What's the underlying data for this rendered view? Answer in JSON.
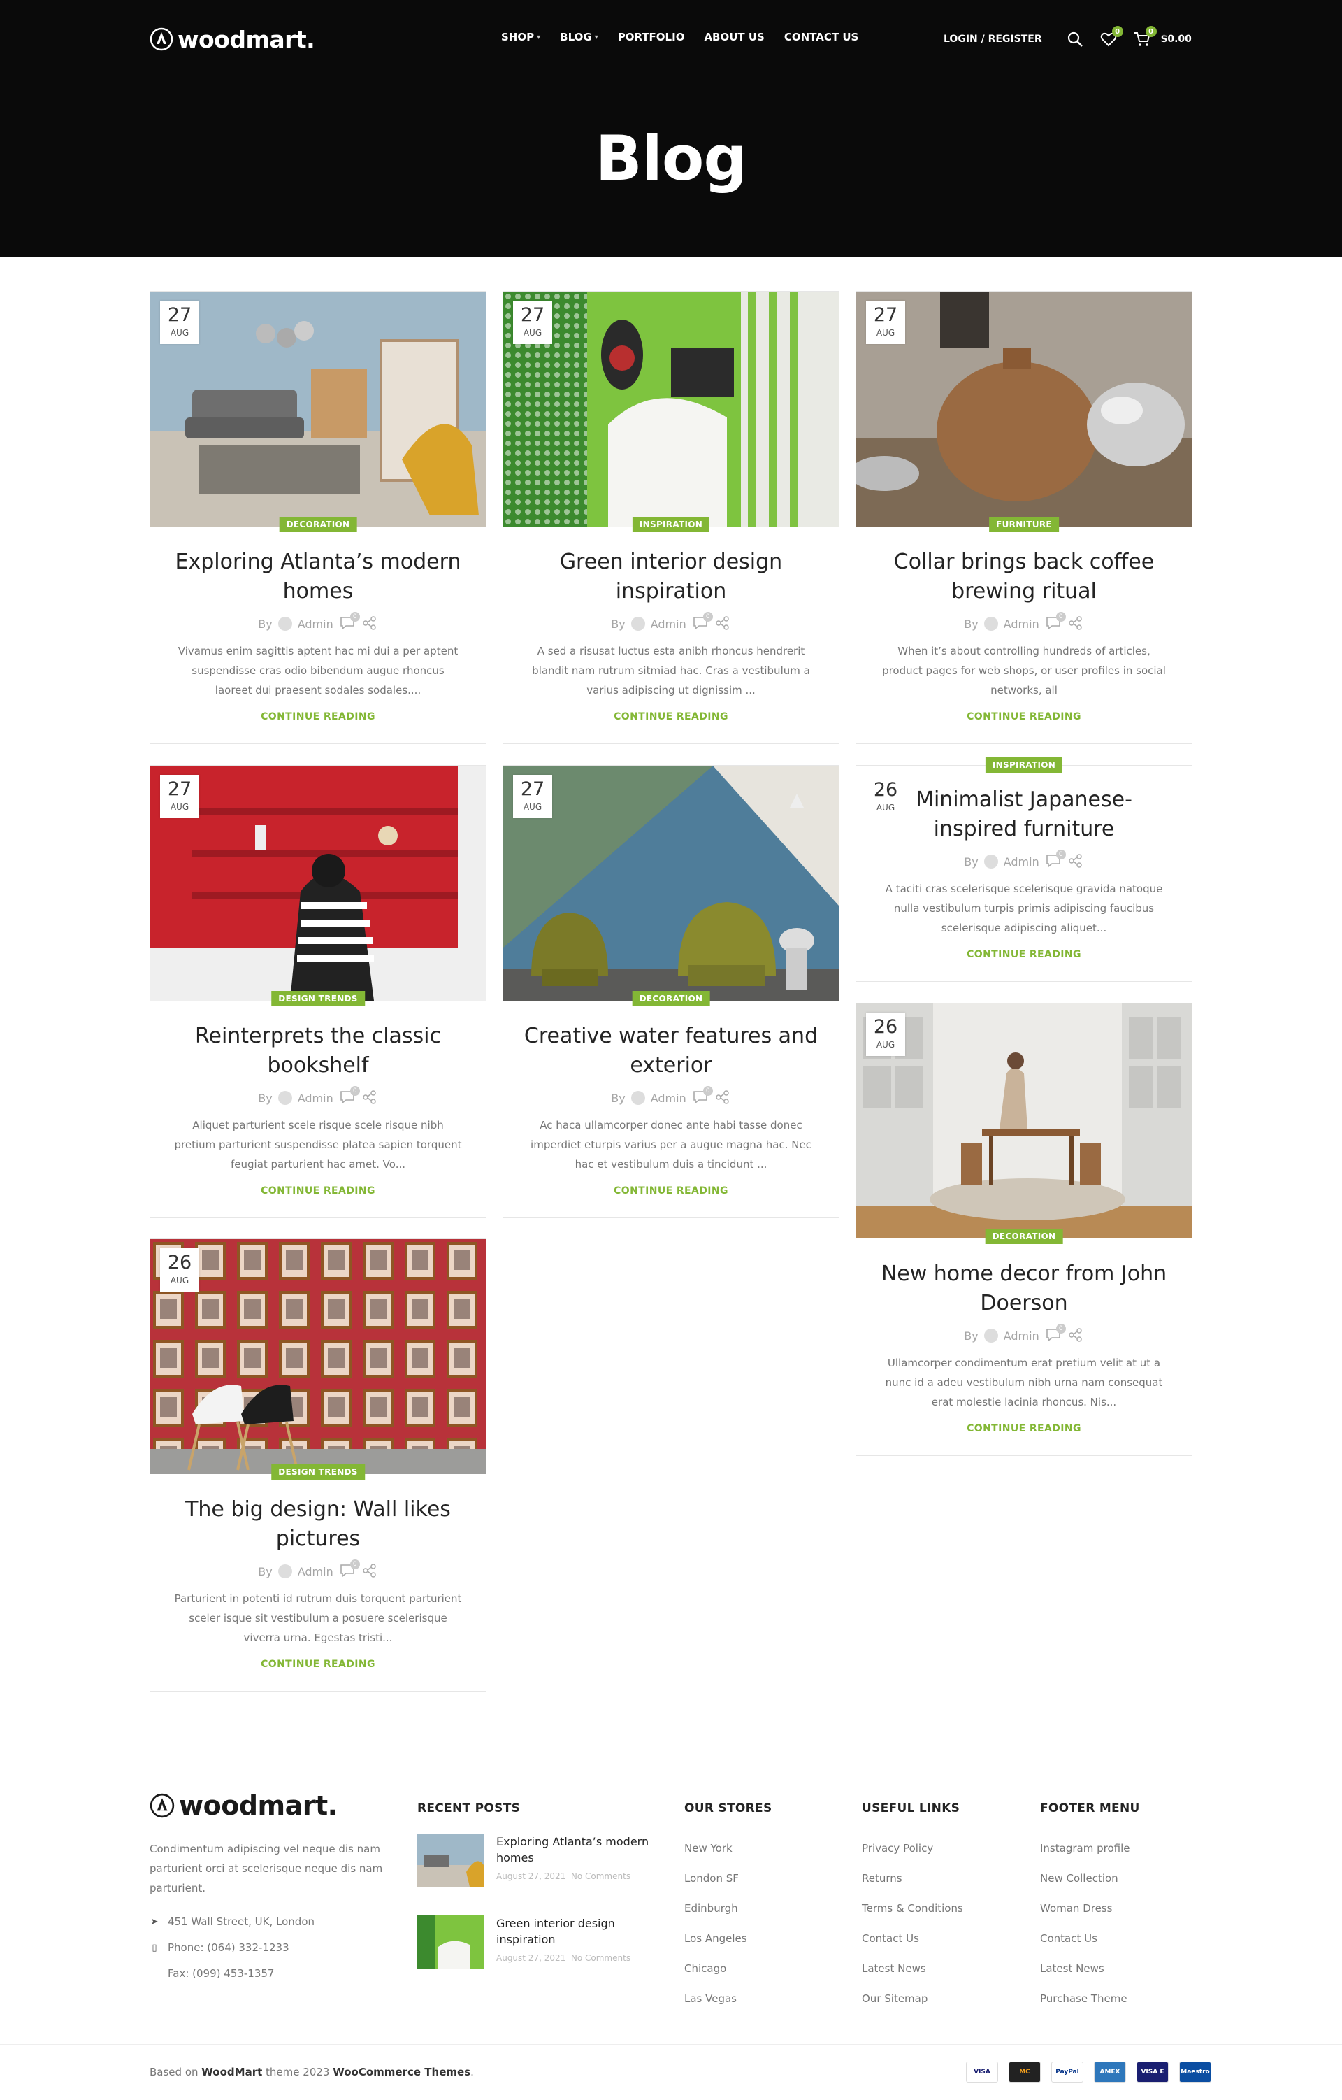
{
  "header": {
    "logo": "woodmart.",
    "nav": [
      {
        "label": "SHOP",
        "caret": true
      },
      {
        "label": "BLOG",
        "caret": true
      },
      {
        "label": "PORTFOLIO",
        "caret": false
      },
      {
        "label": "ABOUT US",
        "caret": false
      },
      {
        "label": "CONTACT US",
        "caret": false
      }
    ],
    "login": "LOGIN / REGISTER",
    "wishlist_count": "0",
    "cart_count": "0",
    "cart_total": "$0.00",
    "page_title": "Blog"
  },
  "colors": {
    "accent": "#83b735",
    "dark": "#0a0a0a"
  },
  "posts": [
    {
      "day": "27",
      "month": "AUG",
      "category": "DECORATION",
      "title": "Exploring Atlanta’s modern homes",
      "by": "By",
      "author": "Admin",
      "comments": "0",
      "excerpt": "Vivamus enim sagittis aptent hac mi dui a per aptent suspendisse cras odio bibendum augue rhoncus laoreet dui praesent sodales sodales....",
      "more": "CONTINUE READING",
      "image": "living-room"
    },
    {
      "day": "27",
      "month": "AUG",
      "category": "INSPIRATION",
      "title": "Green interior design inspiration",
      "by": "By",
      "author": "Admin",
      "comments": "0",
      "excerpt": "A sed a risusat luctus esta anibh rhoncus hendrerit blandit nam rutrum sitmiad hac. Cras a vestibulum a varius adipiscing ut dignissim ...",
      "more": "CONTINUE READING",
      "image": "green-bar"
    },
    {
      "day": "27",
      "month": "AUG",
      "category": "FURNITURE",
      "title": "Collar brings back coffee brewing ritual",
      "by": "By",
      "author": "Admin",
      "comments": "0",
      "excerpt": "When it’s about controlling hundreds of articles, product pages for web shops, or user profiles in social networks, all",
      "more": "CONTINUE READING",
      "image": "wooden-vase"
    },
    {
      "day": "27",
      "month": "AUG",
      "category": "DESIGN TRENDS",
      "title": "Reinterprets the classic bookshelf",
      "by": "By",
      "author": "Admin",
      "comments": "0",
      "excerpt": "Aliquet parturient scele risque scele risque nibh pretium parturient suspendisse platea sapien torquent feugiat parturient hac amet. Vo...",
      "more": "CONTINUE READING",
      "image": "red-shelf"
    },
    {
      "day": "27",
      "month": "AUG",
      "category": "DECORATION",
      "title": "Creative water features and exterior",
      "by": "By",
      "author": "Admin",
      "comments": "0",
      "excerpt": "Ac haca ullamcorper donec ante habi tasse donec imperdiet eturpis varius per a augue magna hac. Nec hac et vestibulum duis a tincidunt ...",
      "more": "CONTINUE READING",
      "image": "mural-chairs"
    },
    {
      "day": "26",
      "month": "AUG",
      "category": "INSPIRATION",
      "title": "Minimalist Japanese-inspired furniture",
      "by": "By",
      "author": "Admin",
      "comments": "0",
      "excerpt": "A taciti cras scelerisque scelerisque gravida natoque nulla vestibulum turpis primis adipiscing faucibus scelerisque adipiscing aliquet...",
      "more": "CONTINUE READING",
      "image": ""
    },
    {
      "day": "26",
      "month": "AUG",
      "category": "DECORATION",
      "title": "New home decor from John Doerson",
      "by": "By",
      "author": "Admin",
      "comments": "0",
      "excerpt": "Ullamcorper condimentum erat pretium velit at ut a nunc id a adeu vestibulum nibh urna nam consequat erat molestie lacinia rhoncus. Nis...",
      "more": "CONTINUE READING",
      "image": "dining-room"
    },
    {
      "day": "26",
      "month": "AUG",
      "category": "DESIGN TRENDS",
      "title": "The big design: Wall likes pictures",
      "by": "By",
      "author": "Admin",
      "comments": "0",
      "excerpt": "Parturient in potenti id rutrum duis torquent parturient sceler isque sit vestibulum a posuere scelerisque viverra urna. Egestas tristi...",
      "more": "CONTINUE READING",
      "image": "picture-wall"
    }
  ],
  "footer": {
    "logo": "woodmart.",
    "description": "Condimentum adipiscing vel neque dis nam parturient orci at scelerisque neque dis nam parturient.",
    "address": "451 Wall Street, UK, London",
    "phone": "Phone: (064) 332-1233",
    "fax": "Fax: (099) 453-1357",
    "recent_heading": "RECENT POSTS",
    "recent": [
      {
        "title": "Exploring Atlanta’s modern homes",
        "date": "August 27, 2021",
        "comments": "No Comments"
      },
      {
        "title": "Green interior design inspiration",
        "date": "August 27, 2021",
        "comments": "No Comments"
      }
    ],
    "stores_heading": "OUR STORES",
    "stores": [
      "New York",
      "London SF",
      "Edinburgh",
      "Los Angeles",
      "Chicago",
      "Las Vegas"
    ],
    "links_heading": "USEFUL LINKS",
    "links": [
      "Privacy Policy",
      "Returns",
      "Terms & Conditions",
      "Contact Us",
      "Latest News",
      "Our Sitemap"
    ],
    "menu_heading": "FOOTER MENU",
    "menu": [
      "Instagram profile",
      "New Collection",
      "Woman Dress",
      "Contact Us",
      "Latest News",
      "Purchase Theme"
    ],
    "copy_prefix": "Based on",
    "copy_brand": "WoodMart",
    "copy_mid": "theme 2023",
    "copy_link": "WooCommerce Themes",
    "copy_end": ".",
    "payments": [
      "VISA",
      "MC",
      "PayPal",
      "AMEX",
      "VISA E",
      "Maestro"
    ]
  }
}
